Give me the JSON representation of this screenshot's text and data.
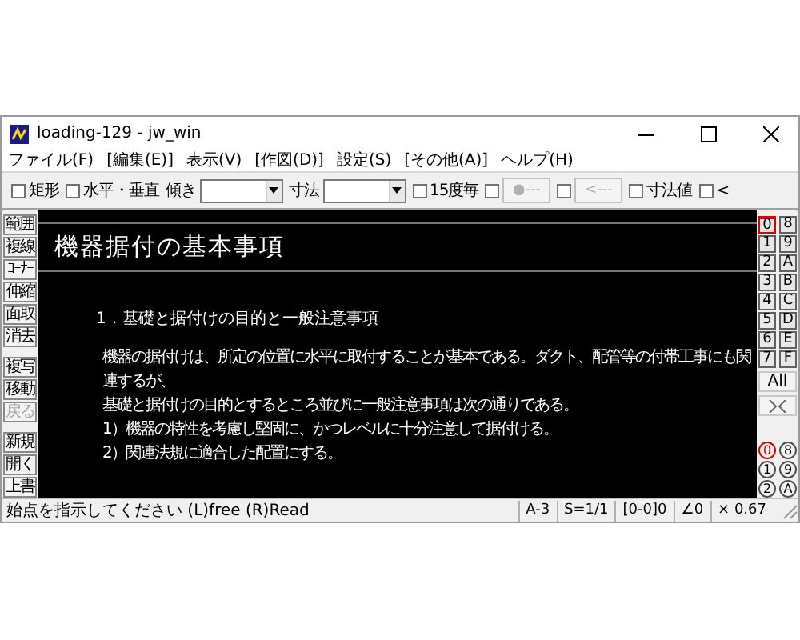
{
  "window": {
    "title": "loading-129 - jw_win"
  },
  "menu": [
    "ファイル(F)",
    "[編集(E)]",
    "表示(V)",
    "[作図(D)]",
    "設定(S)",
    "[その他(A)]",
    "ヘルプ(H)"
  ],
  "toolbar": [
    {
      "kind": "check",
      "label": "矩形",
      "checked": false,
      "disabled": false
    },
    {
      "kind": "check",
      "label": "水平・垂直",
      "checked": false,
      "disabled": false
    },
    {
      "kind": "combo",
      "label": "傾き"
    },
    {
      "kind": "combo",
      "label": "寸法"
    },
    {
      "kind": "check",
      "label": "15度毎",
      "checked": false,
      "disabled": false
    },
    {
      "kind": "checkbutton",
      "label": "●---",
      "checked": false,
      "disabled": true
    },
    {
      "kind": "checkbutton",
      "label": "<---",
      "checked": false,
      "disabled": true
    },
    {
      "kind": "check",
      "label": "寸法値",
      "checked": false,
      "disabled": false
    },
    {
      "kind": "check",
      "label": "<",
      "checked": false,
      "disabled": false
    }
  ],
  "tool_groups": [
    {
      "items": [
        {
          "label": "範囲",
          "disabled": false
        },
        {
          "label": "複線",
          "disabled": false
        },
        {
          "label": "ｺｰﾅｰ",
          "disabled": false
        },
        {
          "label": "伸縮",
          "disabled": false
        },
        {
          "label": "面取",
          "disabled": false
        },
        {
          "label": "消去",
          "disabled": false
        }
      ]
    },
    {
      "items": [
        {
          "label": "複写",
          "disabled": false
        },
        {
          "label": "移動",
          "disabled": false
        },
        {
          "label": "戻る",
          "disabled": true
        }
      ]
    },
    {
      "items": [
        {
          "label": "新規",
          "disabled": false
        },
        {
          "label": "開く",
          "disabled": false
        },
        {
          "label": "上書",
          "disabled": false
        }
      ]
    }
  ],
  "canvas": {
    "heading": "機器据付の基本事項",
    "section": "1．基礎と据付けの目的と一般注意事項",
    "lines": [
      "機器の据付けは、所定の位置に水平に取付することが基本である。ダクト、配管等の付帯工事にも関連するが、",
      "基礎と据付けの目的とするところ並びに一般注意事項は次の通りである。",
      "1）機器の特性を考慮し堅固に、かつレベルに十分注意して据付ける。",
      "2）関連法規に適合した配置にする。"
    ]
  },
  "layers": [
    {
      "label": "0",
      "selected": true
    },
    {
      "label": "8",
      "selected": false
    },
    {
      "label": "1",
      "selected": false
    },
    {
      "label": "9",
      "selected": false
    },
    {
      "label": "2",
      "selected": false
    },
    {
      "label": "A",
      "selected": false
    },
    {
      "label": "3",
      "selected": false
    },
    {
      "label": "B",
      "selected": false
    },
    {
      "label": "4",
      "selected": false
    },
    {
      "label": "C",
      "selected": false
    },
    {
      "label": "5",
      "selected": false
    },
    {
      "label": "D",
      "selected": false
    },
    {
      "label": "6",
      "selected": false
    },
    {
      "label": "E",
      "selected": false
    },
    {
      "label": "7",
      "selected": false
    },
    {
      "label": "F",
      "selected": false
    }
  ],
  "all_button": "All",
  "layer_groups": [
    {
      "label": "0",
      "selected": true
    },
    {
      "label": "8",
      "selected": false
    },
    {
      "label": "1",
      "selected": false
    },
    {
      "label": "9",
      "selected": false
    },
    {
      "label": "2",
      "selected": false
    },
    {
      "label": "A",
      "selected": false
    }
  ],
  "status_bar": {
    "message": "始点を指示してください (L)free (R)Read",
    "fields": [
      "A-3",
      "S=1/1",
      "[0-0]0",
      "∠0",
      "× 0.67"
    ]
  }
}
